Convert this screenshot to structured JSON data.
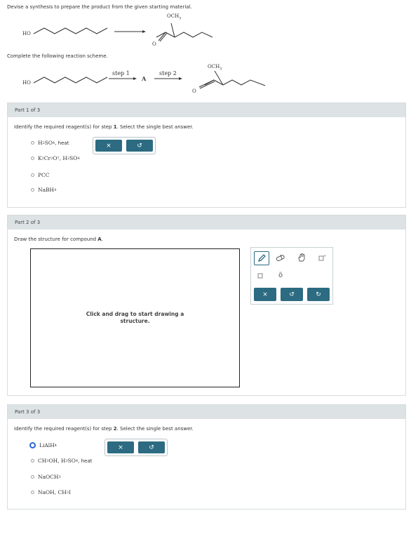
{
  "question": {
    "intro": "Devise a synthesis to prepare the product from the given starting material."
  },
  "scheme_top": {
    "start_label": "HO",
    "product_substituent": "OCH",
    "product_substituent_sub": "3",
    "product_oxygen": "O"
  },
  "complete_scheme": {
    "label": "Complete the following reaction scheme.",
    "start_label": "HO",
    "step1_label": "step 1",
    "intermediate_label": "A",
    "step2_label": "step 2",
    "product_substituent": "OCH",
    "product_substituent_sub": "3",
    "product_oxygen": "O"
  },
  "part1": {
    "header": "Part 1 of 3",
    "prompt_pre": "Identify the required reagent(s) for step ",
    "prompt_bold": "1",
    "prompt_post": ". Select the single best answer.",
    "options": [
      {
        "a": "H",
        "a_sub": "2",
        "b": "SO",
        "b_sub": "4",
        "c": ", heat"
      },
      {
        "a": "K",
        "a_sub": "2",
        "b": "Cr",
        "b_sub": "2",
        "c": "O",
        "c_sub": "7",
        "d": ", H",
        "d_sub": "2",
        "e": "SO",
        "e_sub": "4"
      },
      {
        "a": "PCC"
      },
      {
        "a": "NaBH",
        "a_sub": "4"
      }
    ],
    "clear_label": "×",
    "undo_label": "↺"
  },
  "part2": {
    "header": "Part 2 of 3",
    "prompt_pre": "Draw the structure for compound ",
    "prompt_bold": "A",
    "prompt_post": ".",
    "canvas_msg_1": "Click and drag to start drawing a",
    "canvas_msg_2": "structure.",
    "tools": {
      "clear_label": "×",
      "undo_label": "↺",
      "redo_label": "↻",
      "atom_label": "ö"
    }
  },
  "part3": {
    "header": "Part 3 of 3",
    "prompt_pre": "Identify the required reagent(s) for step ",
    "prompt_bold": "2",
    "prompt_post": ". Select the single best answer.",
    "options": [
      {
        "a": "LiAlH",
        "a_sub": "4",
        "selected": true
      },
      {
        "a": "CH",
        "a_sub": "3",
        "b": "OH, H",
        "b_sub": "2",
        "c": "SO",
        "c_sub": "4",
        "d": ", heat"
      },
      {
        "a": "NaOCH",
        "a_sub": "3"
      },
      {
        "a": "NaOH, CH",
        "a_sub": "3",
        "b": "I"
      }
    ],
    "clear_label": "×",
    "undo_label": "↺"
  },
  "colors": {
    "button": "#2c6b81",
    "header": "#dde2e5",
    "selected_radio": "#2a65d6"
  }
}
